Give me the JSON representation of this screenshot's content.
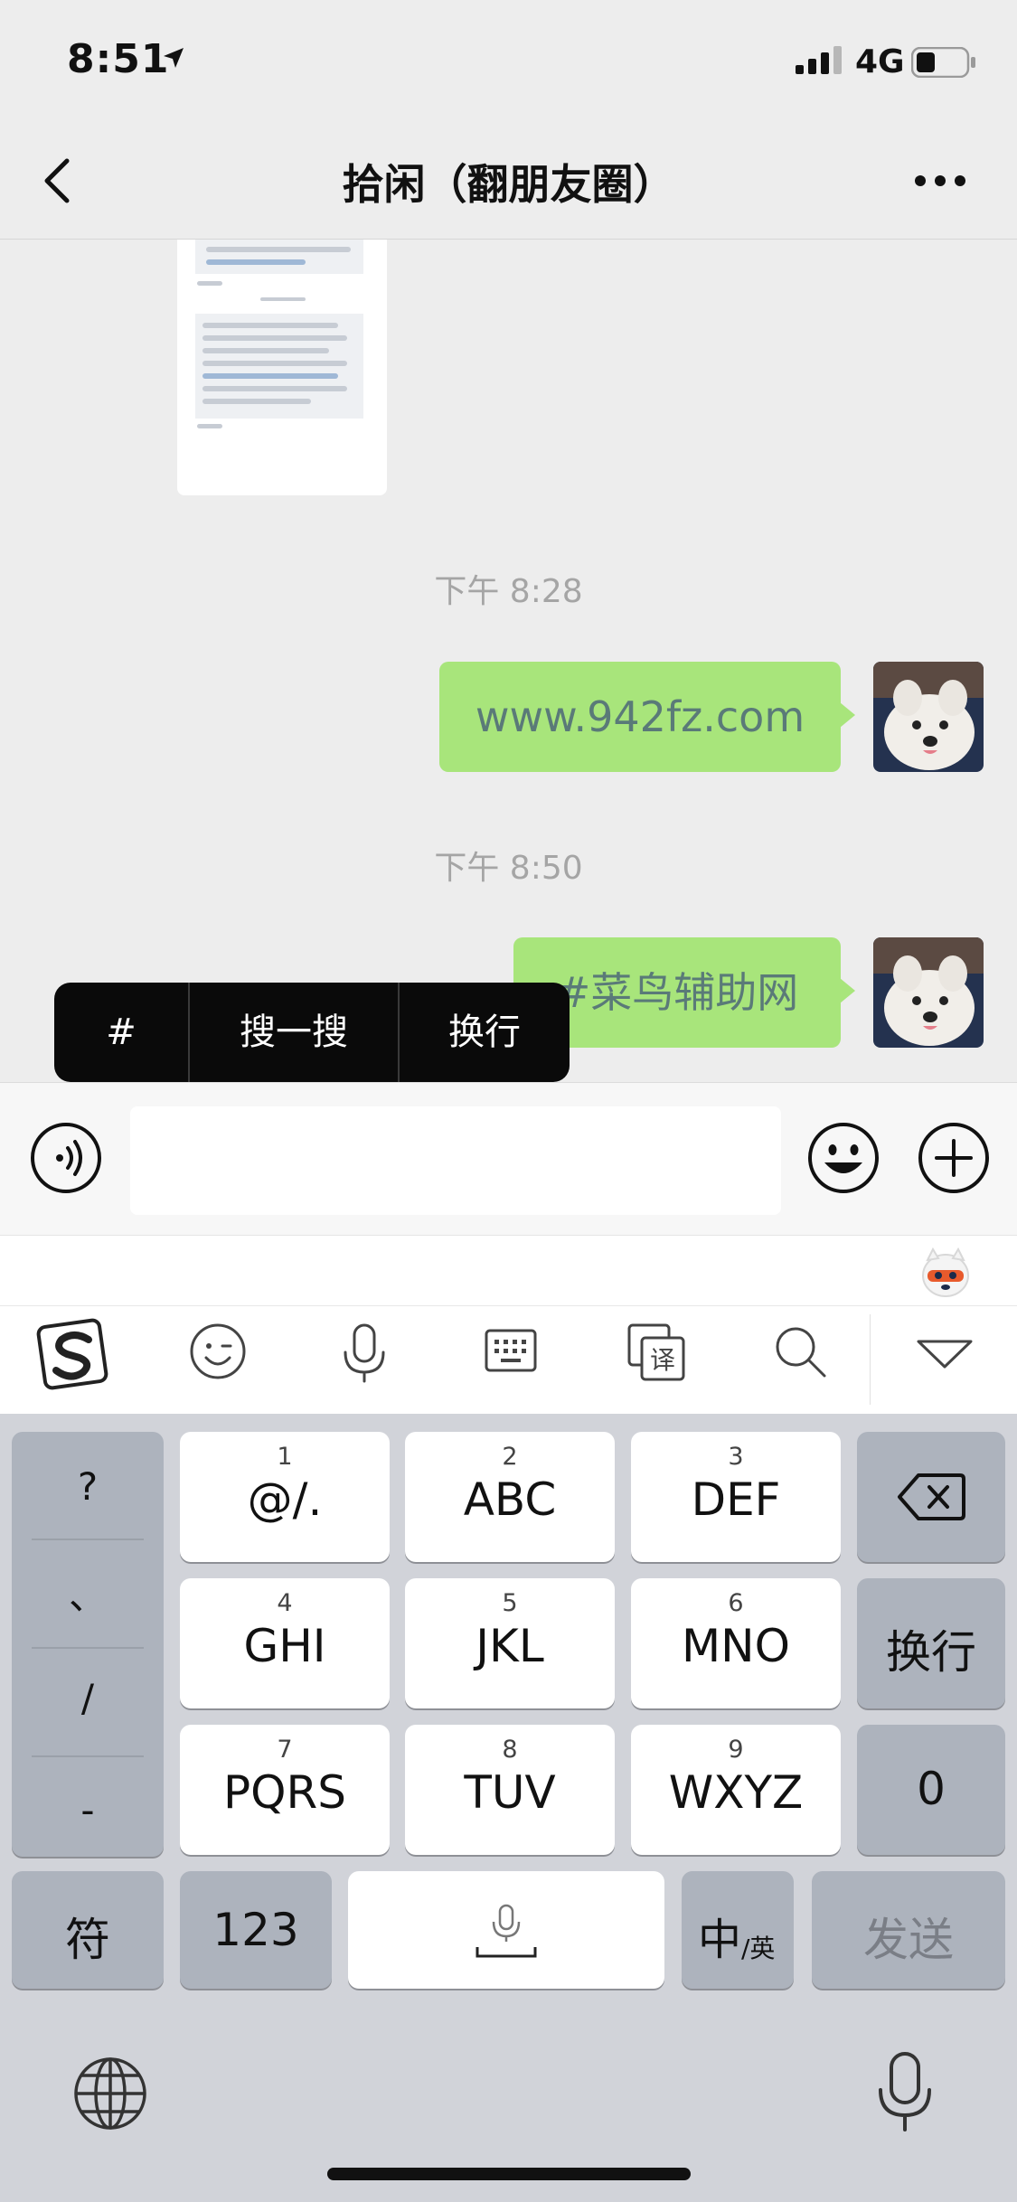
{
  "status_bar": {
    "time": "8:51",
    "network": "4G"
  },
  "header": {
    "title": "拾闲（翻朋友圈）"
  },
  "messages": {
    "timestamp_1": "下午 8:28",
    "bubble_1": "www.942fz.com",
    "timestamp_2": "下午 8:50",
    "bubble_2": "#菜鸟辅助网"
  },
  "context_menu": {
    "item_1": "#",
    "item_2": "搜一搜",
    "item_3": "换行"
  },
  "keyboard": {
    "symbols": [
      "?",
      "、",
      "/",
      "-"
    ],
    "keys": [
      {
        "num": "1",
        "label": "@/."
      },
      {
        "num": "2",
        "label": "ABC"
      },
      {
        "num": "3",
        "label": "DEF"
      },
      {
        "num": "4",
        "label": "GHI"
      },
      {
        "num": "5",
        "label": "JKL"
      },
      {
        "num": "6",
        "label": "MNO"
      },
      {
        "num": "7",
        "label": "PQRS"
      },
      {
        "num": "8",
        "label": "TUV"
      },
      {
        "num": "9",
        "label": "WXYZ"
      }
    ],
    "newline": "换行",
    "zero": "0",
    "symbols_key": "符",
    "numbers_key": "123",
    "lang_main": "中",
    "lang_sub": "/英",
    "send": "发送"
  },
  "colors": {
    "bubble": "#a8e57b",
    "background": "#ededed",
    "keyboard": "#d1d3d9"
  },
  "icons": [
    "location-arrow-icon",
    "signal-icon",
    "battery-icon",
    "back-icon",
    "more-icon",
    "voice-icon",
    "emoji-icon",
    "add-icon",
    "sogou-icon",
    "emoticon-icon",
    "mic-icon",
    "keyboard-icon",
    "translate-icon",
    "search-icon",
    "collapse-icon",
    "backspace-icon",
    "globe-icon",
    "dictation-icon"
  ]
}
